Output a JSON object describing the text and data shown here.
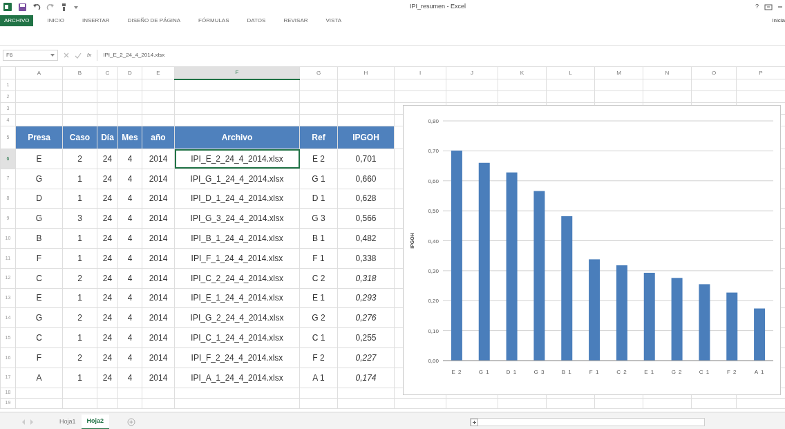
{
  "window": {
    "title": "IPI_resumen - Excel"
  },
  "ribbon_tabs": [
    {
      "label": "ARCHIVO",
      "selected": true
    },
    {
      "label": "INICIO",
      "selected": false
    },
    {
      "label": "INSERTAR",
      "selected": false
    },
    {
      "label": "DISEÑO DE PÁGINA",
      "selected": false
    },
    {
      "label": "FÓRMULAS",
      "selected": false
    },
    {
      "label": "DATOS",
      "selected": false
    },
    {
      "label": "REVISAR",
      "selected": false
    },
    {
      "label": "VISTA",
      "selected": false
    }
  ],
  "help": "?",
  "account": "Inicia",
  "formula_bar": {
    "name_box": "F6",
    "function_label": "fx",
    "formula": "IPI_E_2_24_4_2014.xlsx"
  },
  "column_headers": [
    {
      "label": "A",
      "selected": false
    },
    {
      "label": "B",
      "selected": false
    },
    {
      "label": "C",
      "selected": false
    },
    {
      "label": "D",
      "selected": false
    },
    {
      "label": "E",
      "selected": false
    },
    {
      "label": "F",
      "selected": true
    },
    {
      "label": "G",
      "selected": false
    },
    {
      "label": "H",
      "selected": false
    },
    {
      "label": "I",
      "selected": false
    },
    {
      "label": "J",
      "selected": false
    },
    {
      "label": "K",
      "selected": false
    },
    {
      "label": "L",
      "selected": false
    },
    {
      "label": "M",
      "selected": false
    },
    {
      "label": "N",
      "selected": false
    },
    {
      "label": "O",
      "selected": false
    },
    {
      "label": "P",
      "selected": false
    }
  ],
  "row_headers": [
    {
      "label": "1",
      "selected": false
    },
    {
      "label": "2",
      "selected": false
    },
    {
      "label": "3",
      "selected": false
    },
    {
      "label": "4",
      "selected": false
    },
    {
      "label": "5",
      "selected": false
    },
    {
      "label": "6",
      "selected": true
    },
    {
      "label": "7",
      "selected": false
    },
    {
      "label": "8",
      "selected": false
    },
    {
      "label": "9",
      "selected": false
    },
    {
      "label": "10",
      "selected": false
    },
    {
      "label": "11",
      "selected": false
    },
    {
      "label": "12",
      "selected": false
    },
    {
      "label": "13",
      "selected": false
    },
    {
      "label": "14",
      "selected": false
    },
    {
      "label": "15",
      "selected": false
    },
    {
      "label": "16",
      "selected": false
    },
    {
      "label": "17",
      "selected": false
    },
    {
      "label": "18",
      "selected": false
    },
    {
      "label": "19",
      "selected": false
    }
  ],
  "table": {
    "columns": [
      "Presa",
      "Caso",
      "Día",
      "Mes",
      "año",
      "Archivo",
      "Ref",
      "IPGOH"
    ],
    "rows": [
      {
        "cells": [
          "E",
          "2",
          "24",
          "4",
          "2014",
          "IPI_E_2_24_4_2014.xlsx",
          "E 2",
          "0,701"
        ],
        "active_file": true,
        "value_italic": false
      },
      {
        "cells": [
          "G",
          "1",
          "24",
          "4",
          "2014",
          "IPI_G_1_24_4_2014.xlsx",
          "G 1",
          "0,660"
        ],
        "active_file": false,
        "value_italic": false
      },
      {
        "cells": [
          "D",
          "1",
          "24",
          "4",
          "2014",
          "IPI_D_1_24_4_2014.xlsx",
          "D 1",
          "0,628"
        ],
        "active_file": false,
        "value_italic": false
      },
      {
        "cells": [
          "G",
          "3",
          "24",
          "4",
          "2014",
          "IPI_G_3_24_4_2014.xlsx",
          "G 3",
          "0,566"
        ],
        "active_file": false,
        "value_italic": false
      },
      {
        "cells": [
          "B",
          "1",
          "24",
          "4",
          "2014",
          "IPI_B_1_24_4_2014.xlsx",
          "B 1",
          "0,482"
        ],
        "active_file": false,
        "value_italic": false
      },
      {
        "cells": [
          "F",
          "1",
          "24",
          "4",
          "2014",
          "IPI_F_1_24_4_2014.xlsx",
          "F 1",
          "0,338"
        ],
        "active_file": false,
        "value_italic": false
      },
      {
        "cells": [
          "C",
          "2",
          "24",
          "4",
          "2014",
          "IPI_C_2_24_4_2014.xlsx",
          "C 2",
          "0,318"
        ],
        "active_file": false,
        "value_italic": true
      },
      {
        "cells": [
          "E",
          "1",
          "24",
          "4",
          "2014",
          "IPI_E_1_24_4_2014.xlsx",
          "E 1",
          "0,293"
        ],
        "active_file": false,
        "value_italic": true
      },
      {
        "cells": [
          "G",
          "2",
          "24",
          "4",
          "2014",
          "IPI_G_2_24_4_2014.xlsx",
          "G 2",
          "0,276"
        ],
        "active_file": false,
        "value_italic": true
      },
      {
        "cells": [
          "C",
          "1",
          "24",
          "4",
          "2014",
          "IPI_C_1_24_4_2014.xlsx",
          "C 1",
          "0,255"
        ],
        "active_file": false,
        "value_italic": false
      },
      {
        "cells": [
          "F",
          "2",
          "24",
          "4",
          "2014",
          "IPI_F_2_24_4_2014.xlsx",
          "F 2",
          "0,227"
        ],
        "active_file": false,
        "value_italic": true
      },
      {
        "cells": [
          "A",
          "1",
          "24",
          "4",
          "2014",
          "IPI_A_1_24_4_2014.xlsx",
          "A 1",
          "0,174"
        ],
        "active_file": false,
        "value_italic": true
      }
    ]
  },
  "chart": {
    "chart_data": {
      "type": "bar",
      "ylabel": "IPGOH",
      "categories": [
        "E 2",
        "G 1",
        "D 1",
        "G 3",
        "B 1",
        "F 1",
        "C 2",
        "E 1",
        "G 2",
        "C 1",
        "F 2",
        "A 1"
      ],
      "grid": true,
      "series": [
        {
          "color": "#4a7ebb",
          "values": [
            0.701,
            0.66,
            0.628,
            0.566,
            0.482,
            0.338,
            0.318,
            0.293,
            0.276,
            0.255,
            0.227,
            0.174
          ]
        }
      ],
      "ylim": [
        0,
        0.8
      ],
      "yticks": [
        {
          "value": 0,
          "label": "0,00"
        },
        {
          "value": 0.1,
          "label": "0,10"
        },
        {
          "value": 0.2,
          "label": "0,20"
        },
        {
          "value": 0.3,
          "label": "0,30"
        },
        {
          "value": 0.4,
          "label": "0,40"
        },
        {
          "value": 0.5,
          "label": "0,50"
        },
        {
          "value": 0.6,
          "label": "0,60"
        },
        {
          "value": 0.7,
          "label": "0,70"
        },
        {
          "value": 0.8,
          "label": "0,80"
        }
      ]
    }
  },
  "sheet_tabs": [
    {
      "label": "Hoja1",
      "selected": false
    },
    {
      "label": "Hoja2",
      "selected": true
    }
  ]
}
